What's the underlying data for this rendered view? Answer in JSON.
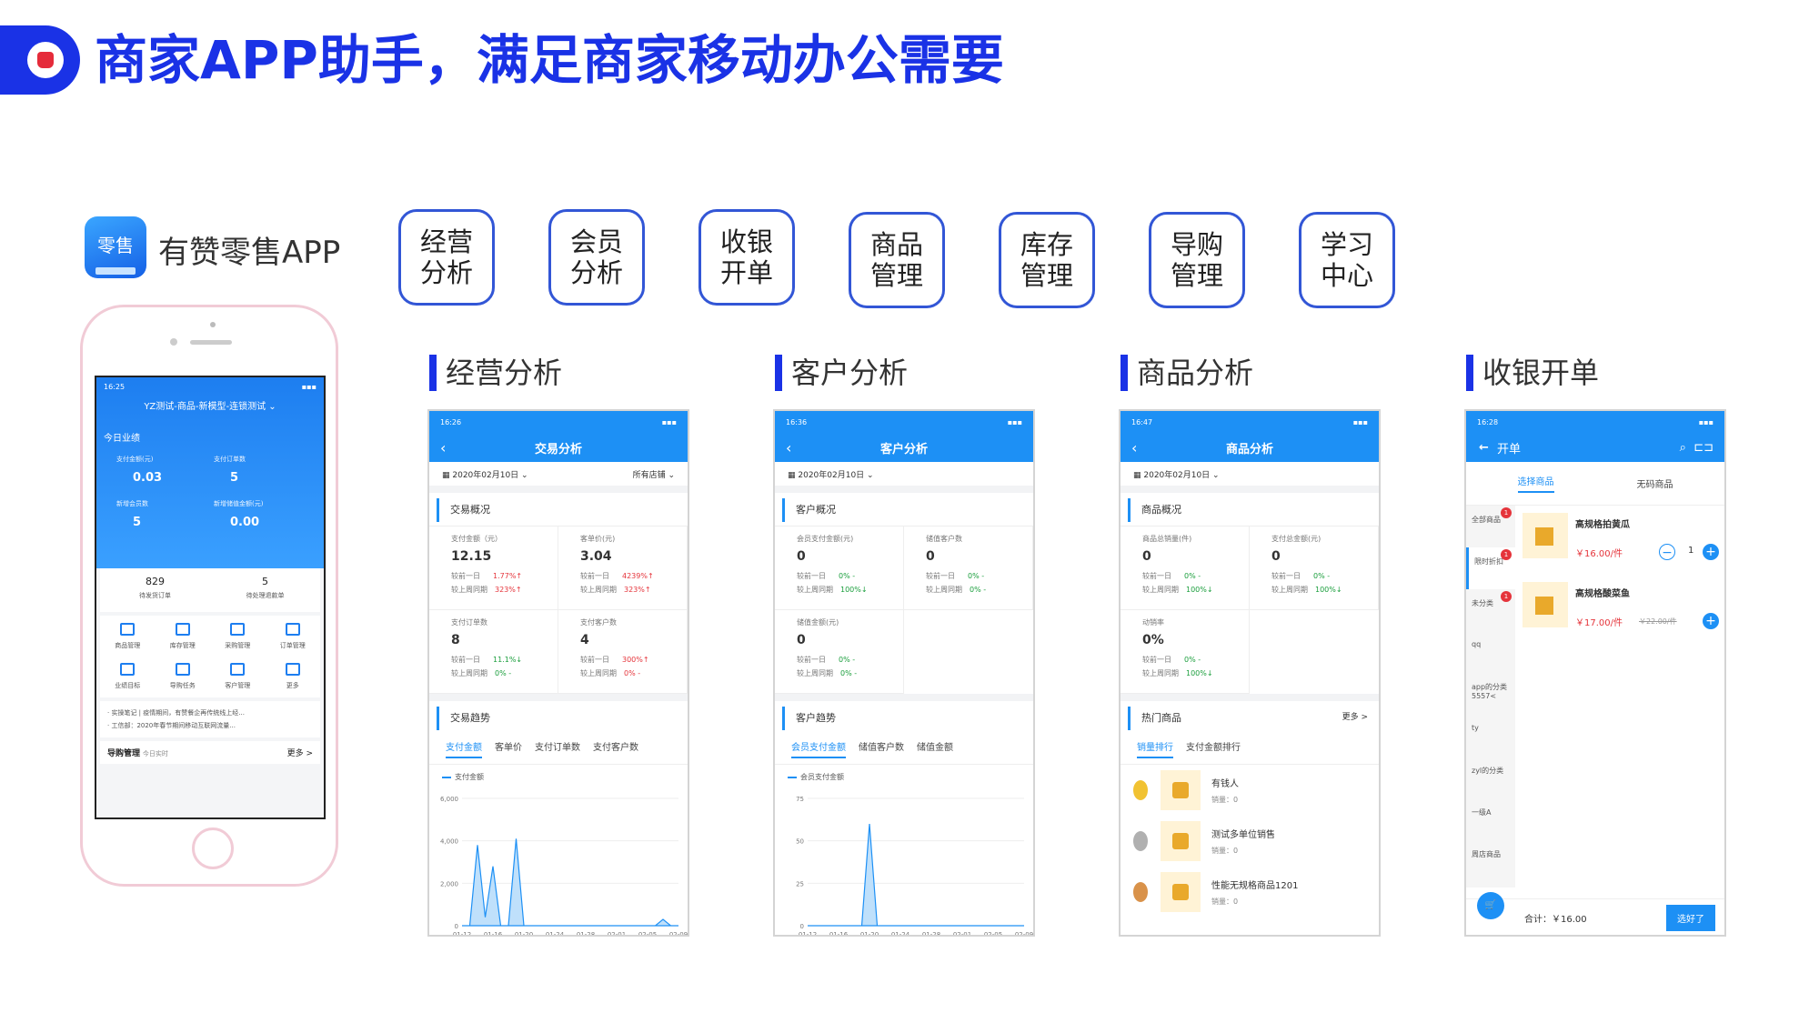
{
  "header": {
    "title": "商家APP助手，满足商家移动办公需要"
  },
  "app": {
    "logo_text": "零售",
    "name": "有赞零售APP"
  },
  "modules": [
    "经营\n分析",
    "会员\n分析",
    "收银\n开单",
    "商品\n管理",
    "库存\n管理",
    "导购\n管理",
    "学习\n中心"
  ],
  "sections": [
    "经营分析",
    "客户分析",
    "商品分析",
    "收银开单"
  ],
  "phone": {
    "status": "16:25",
    "store": "YZ测试-商品-新模型-连锁测试",
    "today": "今日业绩",
    "metrics": [
      {
        "label": "支付金额(元)",
        "value": "0.03"
      },
      {
        "label": "支付订单数",
        "value": "5"
      },
      {
        "label": "新增会员数",
        "value": "5"
      },
      {
        "label": "新增储值金额(元)",
        "value": "0.00"
      }
    ],
    "counts": [
      {
        "value": "829",
        "label": "待发货订单"
      },
      {
        "value": "5",
        "label": "待处理退款单"
      }
    ],
    "icons": [
      "商品管理",
      "库存管理",
      "采购管理",
      "订单管理",
      "业绩目标",
      "导购任务",
      "客户管理",
      "更多"
    ],
    "news": [
      "· 实操笔记 | 疫情期间，有赞餐企再传统线上经...",
      "· 工信部：2020年春节期间移动互联网流量..."
    ],
    "footer": {
      "left": "导购管理",
      "sub": "今日实时",
      "right": "更多 >"
    }
  },
  "trade": {
    "status": "16:26",
    "title": "交易分析",
    "date": "2020年02月10日",
    "store": "所有店铺",
    "overview": "交易概况",
    "cells": [
      {
        "label": "支付金额（元）",
        "value": "12.15",
        "r1": "较前一日",
        "r1v": "1.77%↑",
        "r2": "较上周同期",
        "r2v": "323%↑",
        "color": "up"
      },
      {
        "label": "客单价(元)",
        "value": "3.04",
        "r1": "较前一日",
        "r1v": "4239%↑",
        "r2": "较上周同期",
        "r2v": "323%↑",
        "color": "up"
      },
      {
        "label": "支付订单数",
        "value": "8",
        "r1": "较前一日",
        "r1v": "11.1%↓",
        "r2": "较上周同期",
        "r2v": "0%  -",
        "color": "dn"
      },
      {
        "label": "支付客户数",
        "value": "4",
        "r1": "较前一日",
        "r1v": "300%↑",
        "r2": "较上周同期",
        "r2v": "0%  -",
        "color": "up"
      }
    ],
    "trend": "交易趋势",
    "tabs": [
      "支付金额",
      "客单价",
      "支付订单数",
      "支付客户数"
    ],
    "legend": "支付金额"
  },
  "customer": {
    "status": "16:36",
    "title": "客户分析",
    "date": "2020年02月10日",
    "overview": "客户概况",
    "cells": [
      {
        "label": "会员支付金额(元)",
        "value": "0",
        "r1": "较前一日",
        "r1v": "0%  -",
        "r2": "较上周同期",
        "r2v": "100%↓",
        "color": "dn"
      },
      {
        "label": "储值客户数",
        "value": "0",
        "r1": "较前一日",
        "r1v": "0%  -",
        "r2": "较上周同期",
        "r2v": "0%  -",
        "color": "dn"
      },
      {
        "label": "储值金额(元)",
        "value": "0",
        "r1": "较前一日",
        "r1v": "0%  -",
        "r2": "较上周同期",
        "r2v": "0%  -",
        "color": "dn"
      }
    ],
    "trend": "客户趋势",
    "tabs": [
      "会员支付金额",
      "储值客户数",
      "储值金额"
    ],
    "legend": "会员支付金额"
  },
  "goods": {
    "status": "16:47",
    "title": "商品分析",
    "date": "2020年02月10日",
    "overview": "商品概况",
    "cells": [
      {
        "label": "商品总销量(件)",
        "value": "0",
        "r1": "较前一日",
        "r1v": "0%  -",
        "r2": "较上周同期",
        "r2v": "100%↓",
        "color": "dn"
      },
      {
        "label": "支付总金额(元)",
        "value": "0",
        "r1": "较前一日",
        "r1v": "0%  -",
        "r2": "较上周同期",
        "r2v": "100%↓",
        "color": "dn"
      },
      {
        "label": "动销率",
        "value": "0%",
        "r1": "较前一日",
        "r1v": "0%  -",
        "r2": "较上周同期",
        "r2v": "100%↓",
        "color": "dn"
      }
    ],
    "hot": "热门商品",
    "more": "更多 >",
    "tabs": [
      "销量排行",
      "支付金额排行"
    ],
    "items": [
      {
        "name": "有钱人",
        "sales": "销量：0"
      },
      {
        "name": "测试多单位销售",
        "sales": "销量：0"
      },
      {
        "name": "性能无规格商品1201",
        "sales": "销量：0"
      }
    ]
  },
  "cashier": {
    "status": "16:28",
    "title": "开单",
    "tabs": [
      "选择商品",
      "无码商品"
    ],
    "side": [
      "全部商品",
      "限时折扣",
      "未分类",
      "qq",
      "app的分类5557<",
      "ty",
      "zyl的分类",
      "一级A",
      "周店商品"
    ],
    "items": [
      {
        "name": "高规格拍黄瓜",
        "price": "￥16.00/件",
        "qty": "1"
      },
      {
        "name": "高规格酸菜鱼",
        "price": "￥17.00/件",
        "old": "￥22.00/件"
      }
    ],
    "total": "合计：￥16.00",
    "btn": "选好了"
  },
  "chart_data": [
    {
      "type": "area",
      "title": "交易趋势",
      "series": [
        {
          "name": "支付金额",
          "values": [
            0,
            0,
            3800,
            400,
            2800,
            0,
            0,
            4100,
            0,
            0,
            0,
            0,
            0,
            0,
            0,
            0,
            0,
            0,
            0,
            0,
            0,
            0,
            0,
            0,
            0,
            0,
            300,
            0,
            0
          ]
        }
      ],
      "x": [
        "01-12",
        "01-16",
        "01-20",
        "01-24",
        "01-28",
        "02-01",
        "02-05",
        "02-09"
      ],
      "ylim": [
        0,
        6000
      ],
      "yticks": [
        "6,000",
        "4,000",
        "2,000",
        "0"
      ]
    },
    {
      "type": "area",
      "title": "客户趋势",
      "series": [
        {
          "name": "会员支付金额",
          "values": [
            0,
            0,
            0,
            0,
            0,
            0,
            0,
            0,
            60,
            0,
            0,
            0,
            0,
            0,
            0,
            0,
            0,
            0,
            0,
            0,
            0,
            0,
            0,
            0,
            0,
            0,
            0,
            0,
            0
          ]
        }
      ],
      "x": [
        "01-12",
        "01-16",
        "01-20",
        "01-24",
        "01-28",
        "02-01",
        "02-05",
        "02-09"
      ],
      "ylim": [
        0,
        75
      ],
      "yticks": [
        "75",
        "50",
        "25",
        "0"
      ]
    }
  ],
  "colors": {
    "brand": "#1a32e6",
    "app_blue": "#1d90f5",
    "up": "#e5343b",
    "down": "#1a9e3c"
  }
}
